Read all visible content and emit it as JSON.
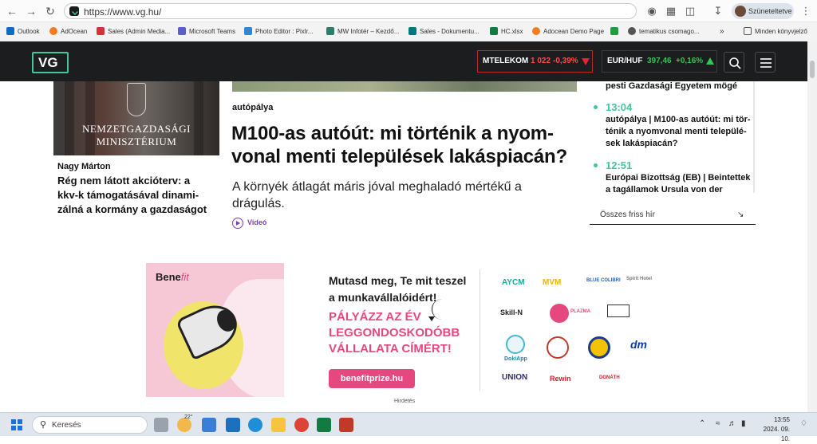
{
  "browser": {
    "url": "https://www.vg.hu/",
    "profile_label": "Szüneteltetve",
    "bookmarks": [
      {
        "label": "Outlook",
        "color": "#0f6cbd"
      },
      {
        "label": "AdOcean",
        "color": "#f47c20"
      },
      {
        "label": "Sales (Admin Media...",
        "color": "#d13438"
      },
      {
        "label": "Microsoft Teams",
        "color": "#5b5fc7"
      },
      {
        "label": "Photo Editor : Pixlr...",
        "color": "#2b88d8"
      },
      {
        "label": "MW Infotér – Kezdő...",
        "color": "#2e7d6b"
      },
      {
        "label": "Sales - Dokumentu...",
        "color": "#03787c"
      },
      {
        "label": "HC.xlsx",
        "color": "#107c41"
      },
      {
        "label": "Adocean Demo Page",
        "color": "#f47c20"
      },
      {
        "label": "",
        "color": "#1e9e3e"
      },
      {
        "label": "tematikus csomago...",
        "color": "#555555"
      }
    ],
    "bookmarks_more": "»",
    "bookmarks_folder": "Minden könyvjelző"
  },
  "site": {
    "logo": "VG",
    "tickers": [
      {
        "name": "MTELEKOM",
        "value": "1 022",
        "change": "-0,39%",
        "direction": "down"
      },
      {
        "name": "EUR/HUF",
        "value": "397,46",
        "change": "+0,16%",
        "direction": "up"
      }
    ],
    "search_icon": "search-icon",
    "menu_icon": "menu-icon"
  },
  "left_article": {
    "image_text_1": "NEMZETGAZDASÁGI",
    "image_text_2": "MINISZTÉRIUM",
    "author": "Nagy Márton",
    "title_lines": [
      "Rég nem látott akcióterv: a",
      "kkv-k támogatásával dinami-",
      "zálná a kormány a gazdaságot"
    ]
  },
  "main_article": {
    "category": "autópálya",
    "title_lines": [
      "M100-as autóút: mi történik a nyom-",
      "vonal menti települések lakáspiacán?"
    ],
    "lead_lines": [
      "A környék átlagát máris jóval meghaladó mértékű a",
      "drágulás."
    ],
    "badge": "Videó"
  },
  "news_feed": {
    "partial_top": "pesti Gazdasági Egyetem mögé",
    "items": [
      {
        "time": "13:04",
        "lines": [
          "autópálya | M100-as autóút: mi tör-",
          "ténik a nyomvonal menti települé-",
          "sek lakáspiacán?"
        ]
      },
      {
        "time": "12:51",
        "lines": [
          "Európai Bizottság (EB) | Beintettek",
          "a tagállamok Ursula von der"
        ]
      }
    ],
    "all_news": "Összes friss hír",
    "all_news_arrow": "↘"
  },
  "ad": {
    "brand_bold": "Bene",
    "brand_italic": "fit",
    "tagline_1": "Mutasd meg, Te mit teszel",
    "tagline_2": "a munkavállalóidért!",
    "headline_1": "PÁLYÁZZ AZ ÉV",
    "headline_2": "LEGGONDOSKODÓBB",
    "headline_3": "VÁLLALATA CÍMÉRT!",
    "button": "benefitprize.hu",
    "label": "Hirdetés",
    "logos": [
      "AYCM",
      "MVM",
      "BLUE COLIBRI",
      "Spirit Hotel",
      "Skill-N",
      "PLAZMA",
      "",
      "DokiApp",
      "",
      "",
      "dm",
      "UNION",
      "Rewin",
      "DONÁTH"
    ]
  },
  "taskbar": {
    "search_placeholder": "Keresés",
    "weather": "22°",
    "time": "13:55",
    "date": "2024. 09. 10."
  }
}
